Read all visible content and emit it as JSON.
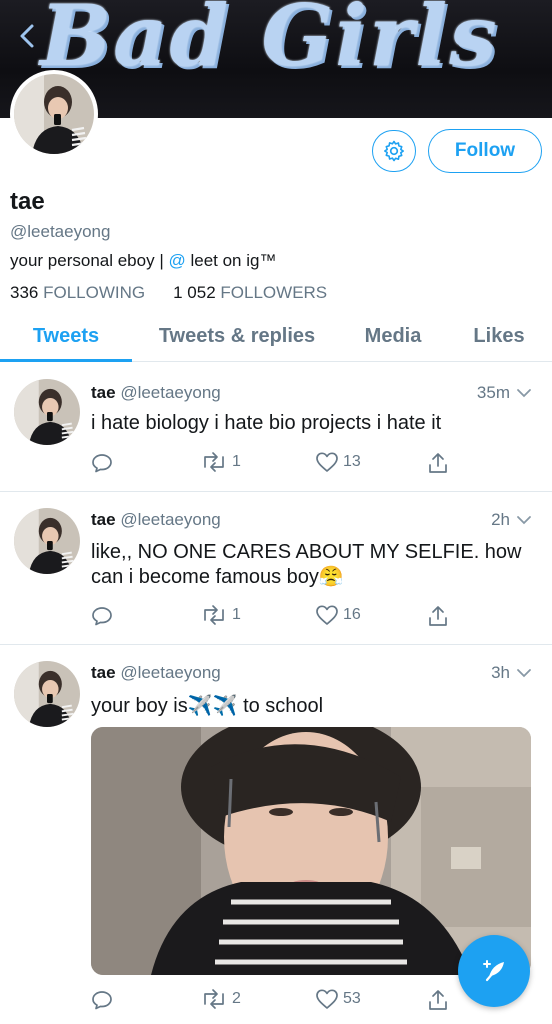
{
  "header": {
    "banner_text": "Bad Girls"
  },
  "profile": {
    "display_name": "tae",
    "handle": "@leetaeyong",
    "bio_prefix": "your personal eboy | ",
    "bio_mention": "@",
    "bio_suffix": " leet on ig™",
    "following_count": "336",
    "following_label": "FOLLOWING",
    "followers_count": "1 052",
    "followers_label": "FOLLOWERS",
    "follow_label": "Follow"
  },
  "tabs": [
    {
      "label": "Tweets"
    },
    {
      "label": "Tweets & replies"
    },
    {
      "label": "Media"
    },
    {
      "label": "Likes"
    }
  ],
  "tweets": [
    {
      "name": "tae",
      "handle": "@leetaeyong",
      "time": "35m",
      "text": "i hate biology i hate bio projects i hate it",
      "retweets": "1",
      "likes": "13"
    },
    {
      "name": "tae",
      "handle": "@leetaeyong",
      "time": "2h",
      "text": "like,, NO ONE CARES ABOUT MY SELFIE. how can i become famous boy😤",
      "retweets": "1",
      "likes": "16"
    },
    {
      "name": "tae",
      "handle": "@leetaeyong",
      "time": "3h",
      "text": "your boy is✈️✈️ to school",
      "retweets": "2",
      "likes": "53"
    }
  ],
  "colors": {
    "accent": "#1da1f2",
    "muted": "#657786",
    "text": "#14171a"
  }
}
